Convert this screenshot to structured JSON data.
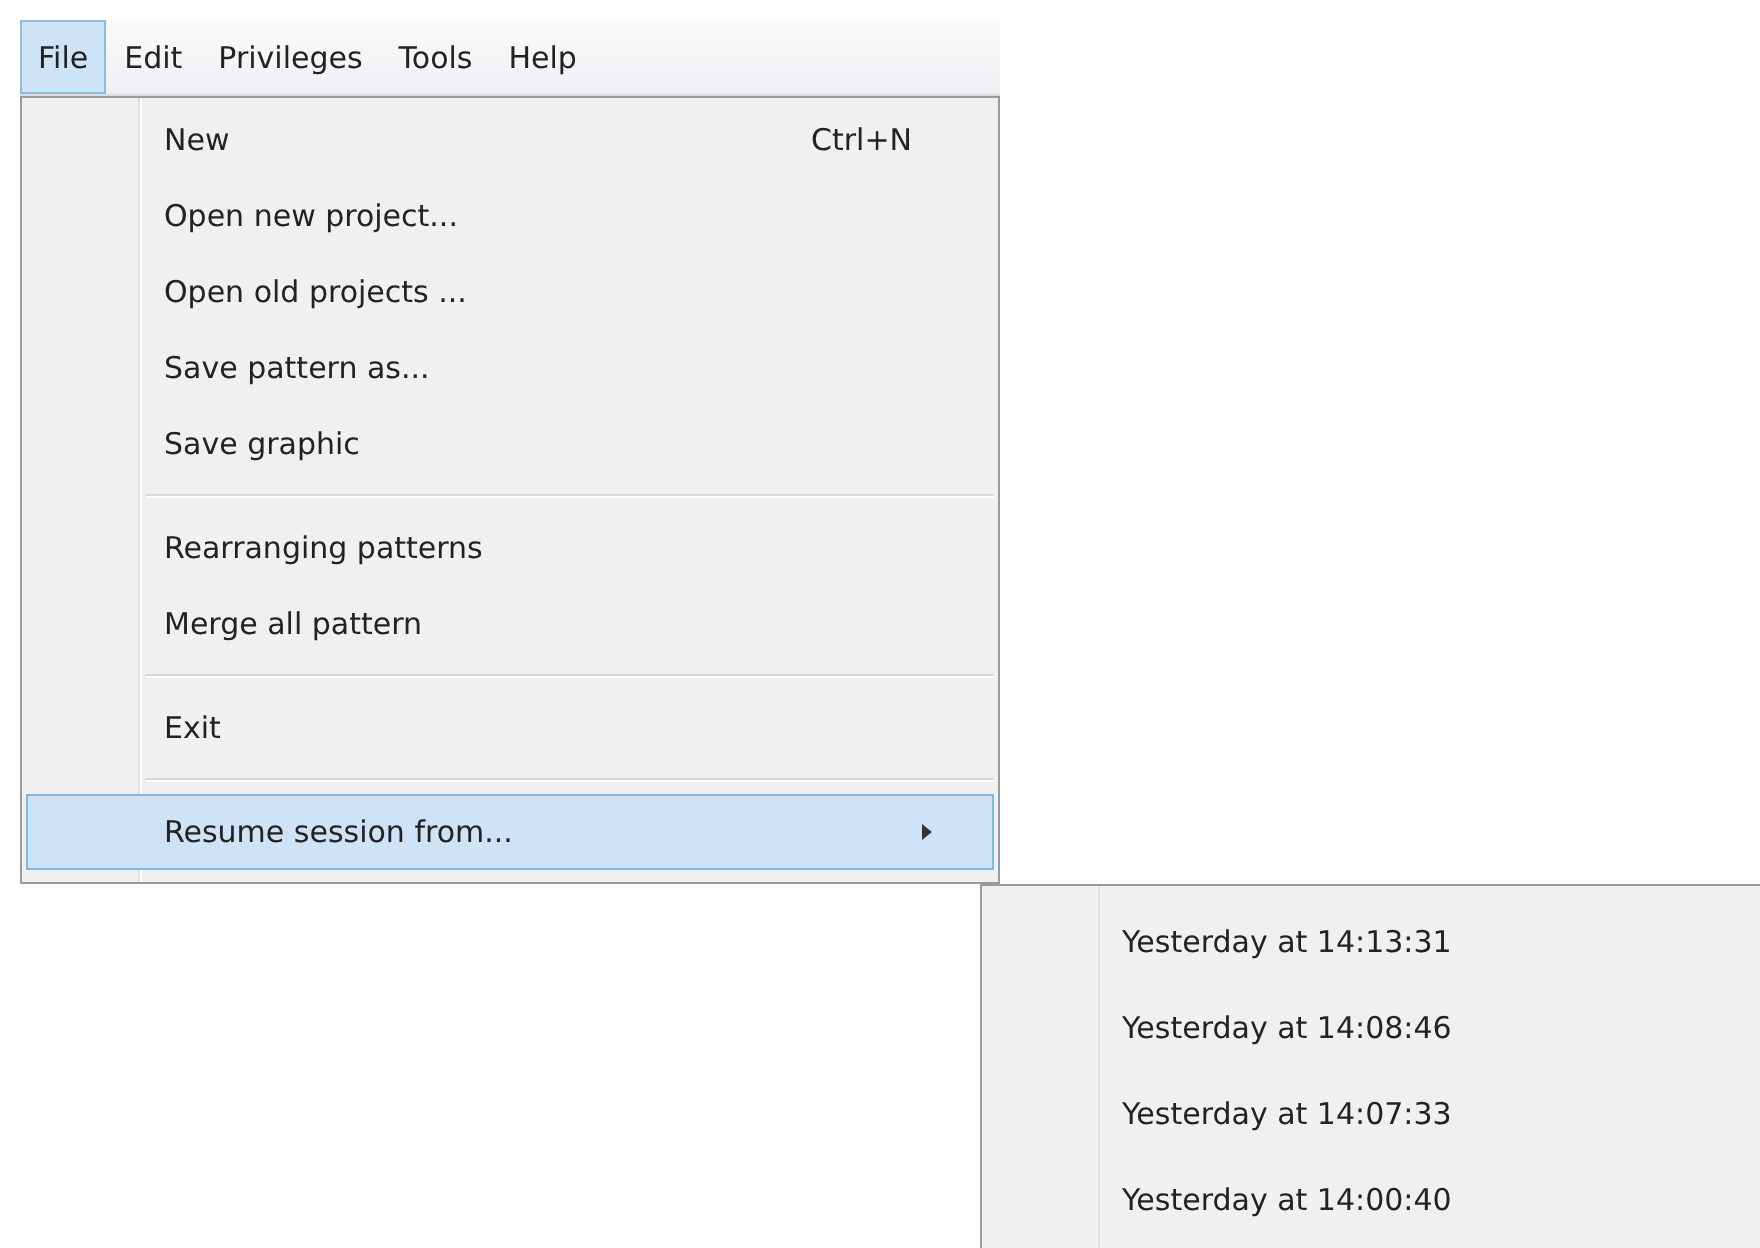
{
  "menubar": [
    {
      "label": "File",
      "selected": true
    },
    {
      "label": "Edit",
      "selected": false
    },
    {
      "label": "Privileges",
      "selected": false
    },
    {
      "label": "Tools",
      "selected": false
    },
    {
      "label": "Help",
      "selected": false
    }
  ],
  "menu": [
    {
      "kind": "item",
      "label": "New",
      "shortcut": "Ctrl+N",
      "selected": false
    },
    {
      "kind": "item",
      "label": "Open new project...",
      "selected": false
    },
    {
      "kind": "item",
      "label": "Open old projects ...",
      "selected": false
    },
    {
      "kind": "item",
      "label": "Save pattern as...",
      "selected": false
    },
    {
      "kind": "item",
      "label": "Save graphic",
      "selected": false
    },
    {
      "kind": "separator"
    },
    {
      "kind": "item",
      "label": "Rearranging patterns",
      "selected": false
    },
    {
      "kind": "item",
      "label": "Merge all pattern",
      "selected": false
    },
    {
      "kind": "separator"
    },
    {
      "kind": "item",
      "label": "Exit",
      "selected": false
    },
    {
      "kind": "separator"
    },
    {
      "kind": "submenu",
      "label": "Resume session from...",
      "selected": true
    }
  ],
  "submenu": [
    {
      "label": "Yesterday at 14:13:31"
    },
    {
      "label": "Yesterday at 14:08:46"
    },
    {
      "label": "Yesterday at 14:07:33"
    },
    {
      "label": "Yesterday at 14:00:40"
    }
  ]
}
